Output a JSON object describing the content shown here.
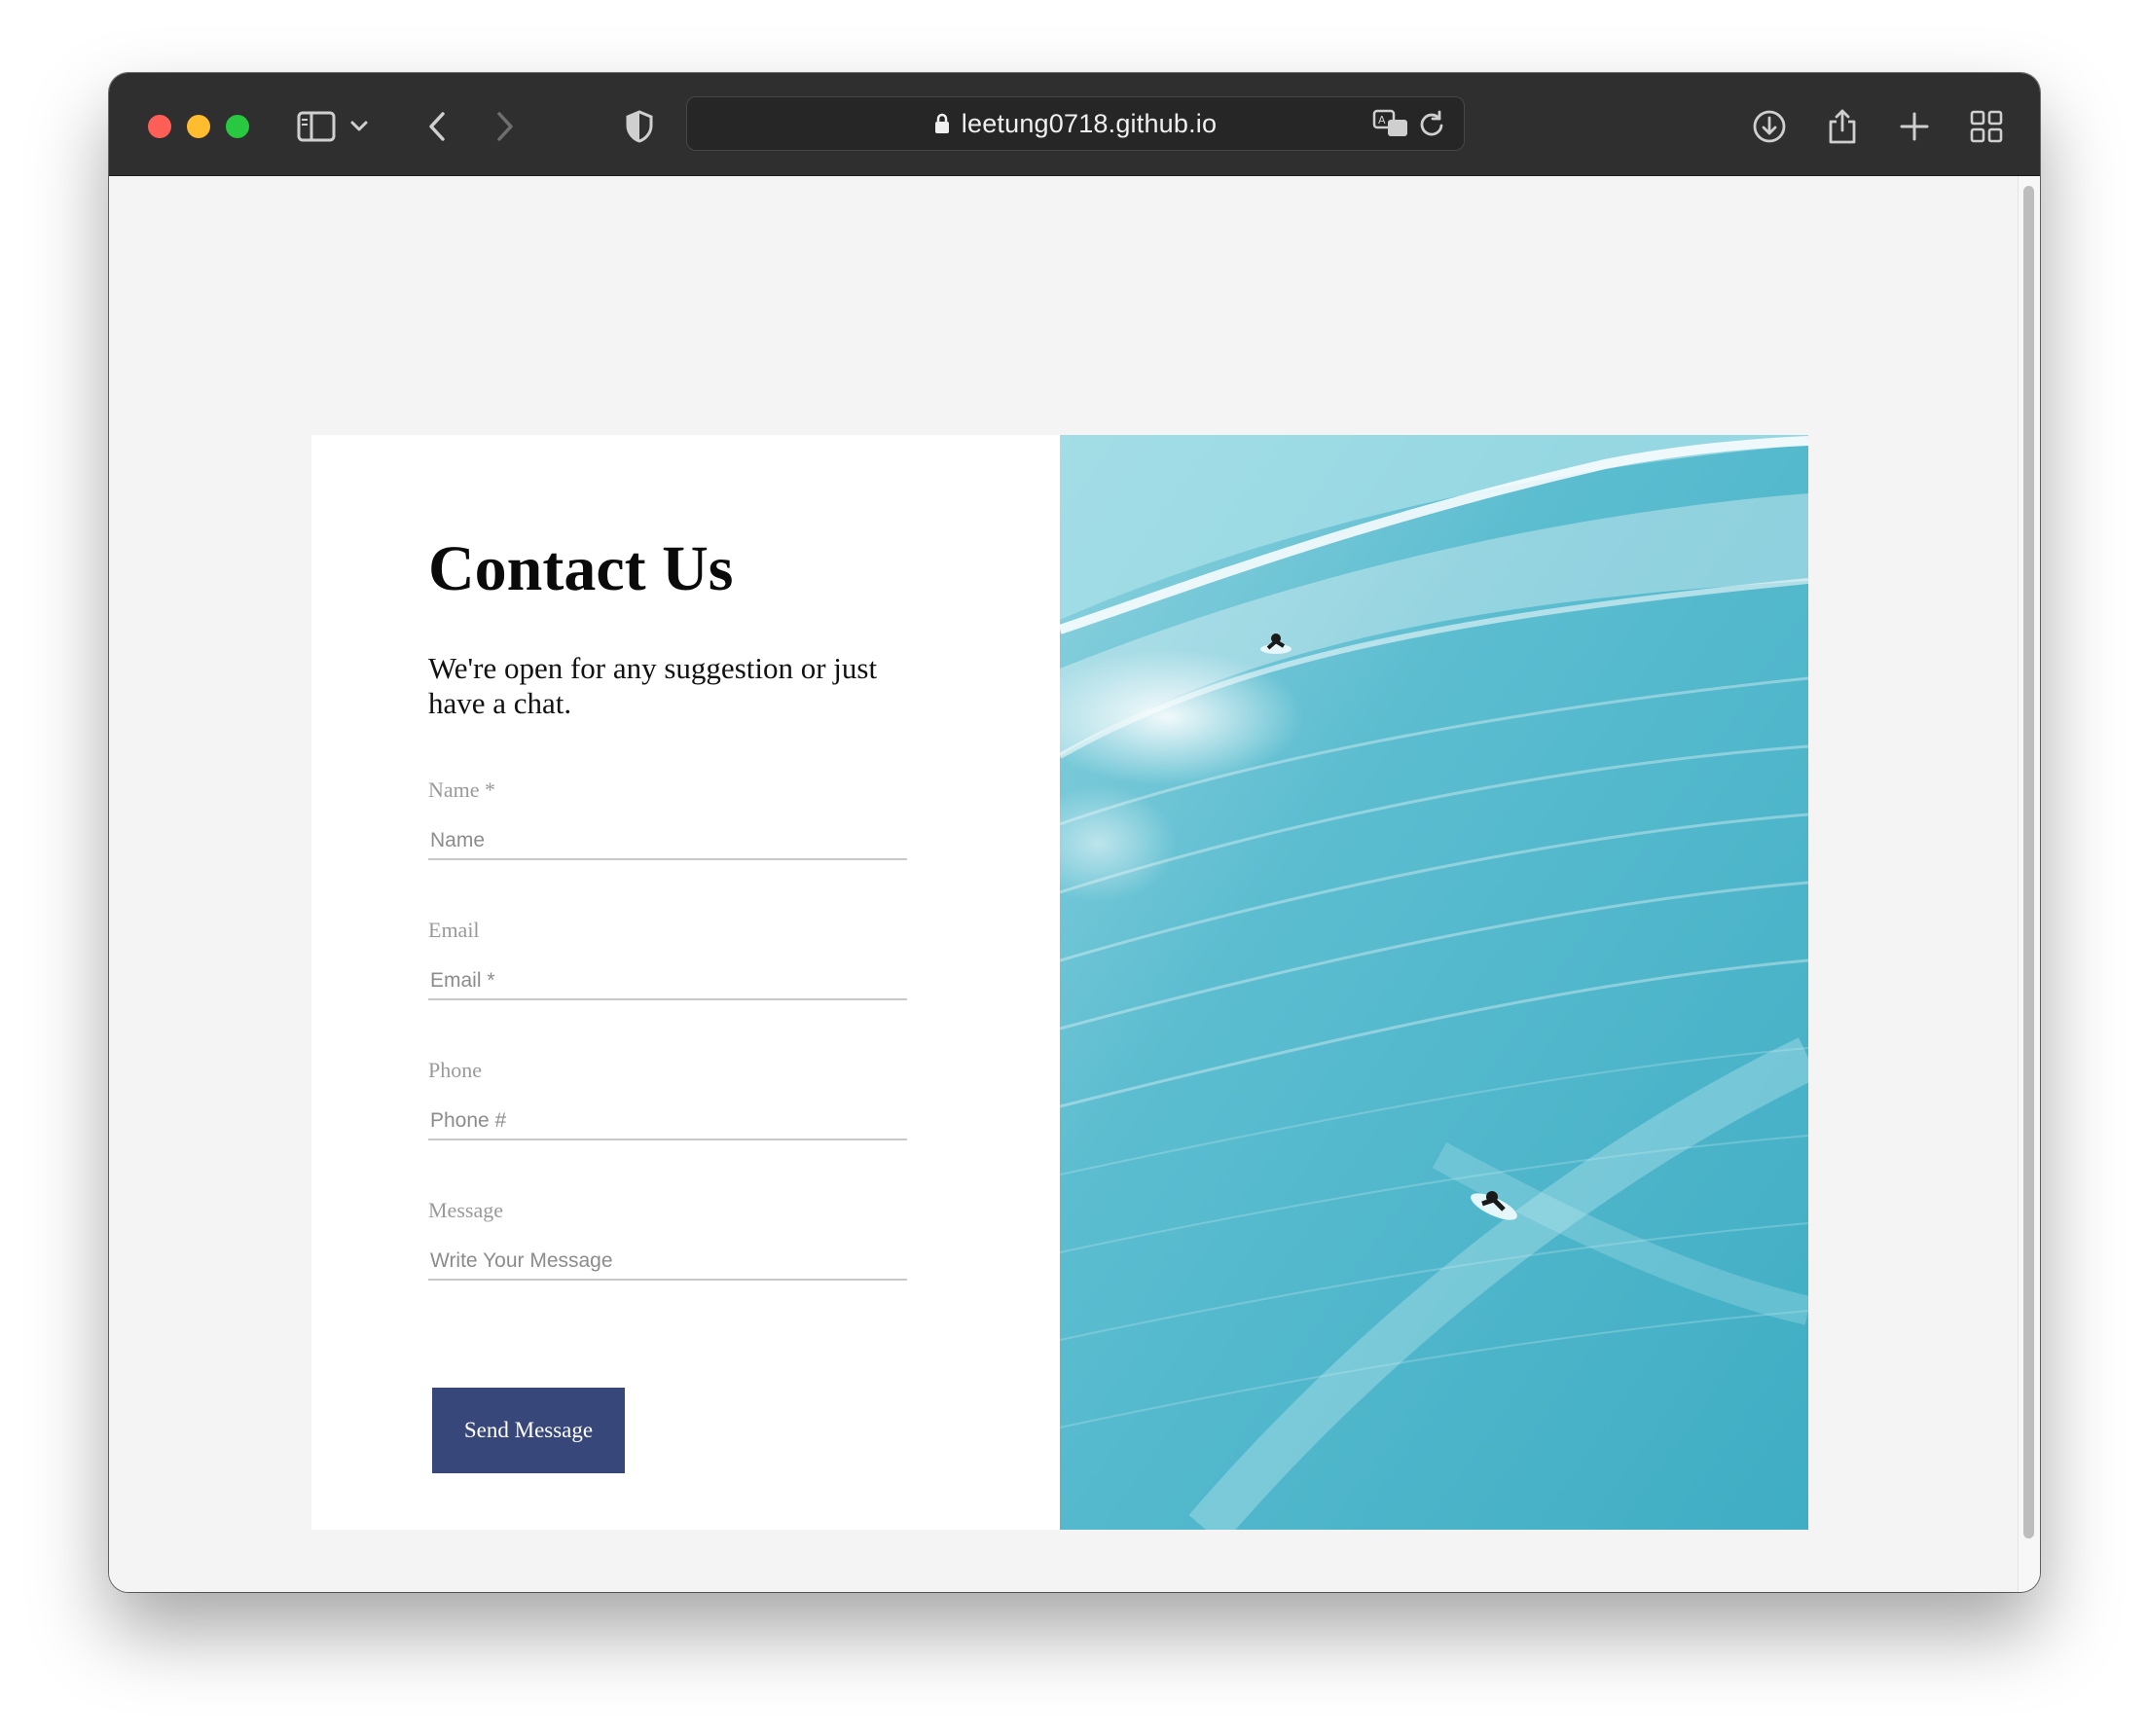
{
  "browser": {
    "url": "leetung0718.github.io",
    "icons": {
      "close": "close-light",
      "minimize": "minimize-light",
      "zoom": "zoom-light",
      "sidebar": "sidebar-icon",
      "tab_menu": "chevron-down-icon",
      "back": "back-arrow-icon",
      "forward": "forward-arrow-icon",
      "privacy": "shield-icon",
      "lock": "lock-icon",
      "translate": "translate-icon",
      "reload": "reload-icon",
      "downloads": "download-icon",
      "share": "share-icon",
      "new_tab": "plus-icon",
      "tab_overview": "grid-icon"
    }
  },
  "contact": {
    "title": "Contact Us",
    "subtitle": "We're open for any suggestion or just have a chat.",
    "fields": [
      {
        "label": "Name *",
        "placeholder": "Name"
      },
      {
        "label": "Email",
        "placeholder": "Email *"
      },
      {
        "label": "Phone",
        "placeholder": "Phone #"
      },
      {
        "label": "Message",
        "placeholder": "Write Your Message"
      }
    ],
    "submit_label": "Send Message"
  },
  "colors": {
    "button": "#38477a",
    "page_bg": "#f4f4f4",
    "toolbar_bg": "#2f2f2f",
    "water": "#5ab9cc"
  }
}
